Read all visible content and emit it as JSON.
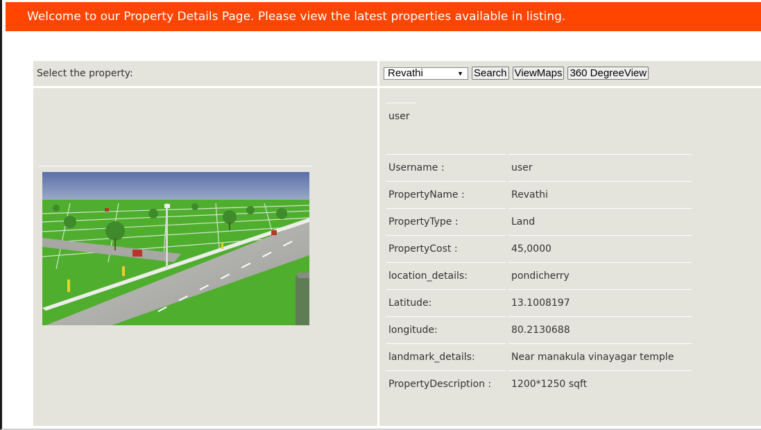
{
  "banner": {
    "text": "Welcome to our Property Details Page. Please view the latest properties available in listing."
  },
  "selector": {
    "label": "Select the property:",
    "selected": "Revathi",
    "search_label": "Search",
    "viewmaps_label": "ViewMaps",
    "degree_label": "360 DegreeView"
  },
  "heading": {
    "user": "user"
  },
  "details": [
    {
      "label": "Username :",
      "value": "user"
    },
    {
      "label": "PropertyName :",
      "value": "Revathi"
    },
    {
      "label": "PropertyType :",
      "value": "Land"
    },
    {
      "label": "PropertyCost :",
      "value": "45,0000"
    },
    {
      "label": "location_details:",
      "value": "pondicherry"
    },
    {
      "label": "Latitude:",
      "value": "13.1008197"
    },
    {
      "label": "longitude:",
      "value": "80.2130688"
    },
    {
      "label": "landmark_details:",
      "value": "Near manakula vinayagar temple"
    },
    {
      "label": "PropertyDescription :",
      "value": "1200*1250 sqft"
    }
  ],
  "colors": {
    "banner": "#ff4500",
    "panel": "#e4e4dc"
  }
}
